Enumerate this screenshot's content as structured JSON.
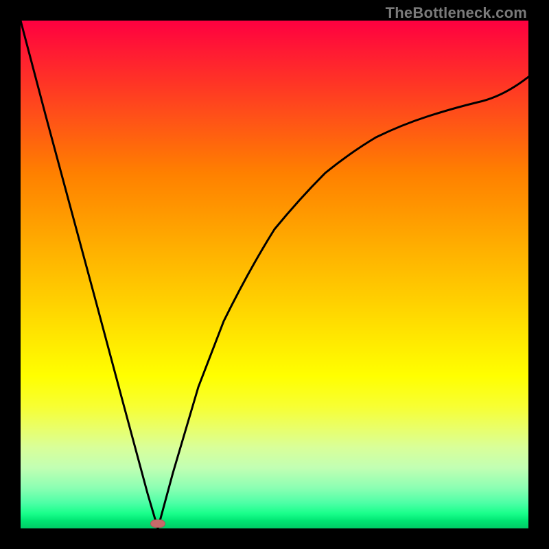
{
  "watermark": "TheBottleneck.com",
  "colors": {
    "frame": "#000000",
    "curve": "#000000",
    "marker": "#c76a6a",
    "gradient_top": "#ff0040",
    "gradient_bottom": "#00cc66"
  },
  "chart_data": {
    "type": "line",
    "title": "",
    "xlabel": "",
    "ylabel": "",
    "xlim": [
      0,
      100
    ],
    "ylim": [
      0,
      100
    ],
    "grid": false,
    "legend": false,
    "series": [
      {
        "name": "bottleneck-curve",
        "x": [
          0,
          5,
          10,
          15,
          20,
          25,
          27,
          30,
          35,
          40,
          45,
          50,
          55,
          60,
          65,
          70,
          75,
          80,
          85,
          90,
          95,
          100
        ],
        "values": [
          100,
          81,
          63,
          44,
          26,
          7,
          0,
          11,
          28,
          41,
          51,
          59,
          65,
          70,
          74,
          78,
          81,
          83,
          85,
          87,
          88,
          89
        ]
      }
    ],
    "annotations": [
      {
        "name": "min-marker",
        "x": 27,
        "y": 0
      }
    ],
    "notes": "Values are estimated from the image (no axis ticks). x and y are normalized to 0–100. The left branch is approximately linear; at x≈27 the curve touches y=0 (the marker). The right branch rises with decreasing slope reaching y≈89 at x=100."
  }
}
